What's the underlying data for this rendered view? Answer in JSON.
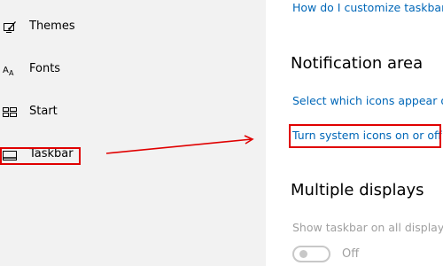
{
  "sidebar": {
    "items": [
      {
        "label": "Themes",
        "icon": "themes-icon"
      },
      {
        "label": "Fonts",
        "icon": "fonts-icon"
      },
      {
        "label": "Start",
        "icon": "start-icon"
      },
      {
        "label": "Taskbar",
        "icon": "taskbar-icon"
      }
    ]
  },
  "main": {
    "top_link": "How do I customize taskbar",
    "notification_area": {
      "heading": "Notification area",
      "links": [
        "Select which icons appear o",
        "Turn system icons on or off"
      ]
    },
    "multiple_displays": {
      "heading": "Multiple displays",
      "setting_label": "Show taskbar on all displays",
      "toggle_state": "Off",
      "toggle_on": false
    }
  },
  "annotations": {
    "color": "#e00000"
  },
  "colors": {
    "link": "#0067b8",
    "sidebar_bg": "#f2f2f2",
    "disabled_text": "#a0a0a0"
  }
}
